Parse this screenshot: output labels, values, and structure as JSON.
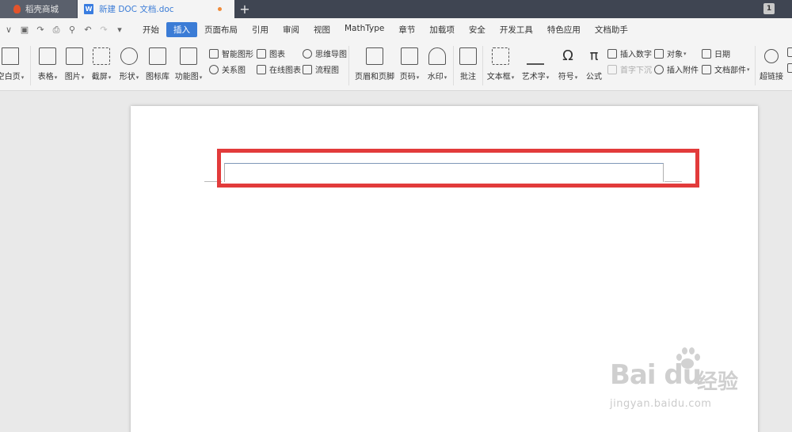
{
  "tabs": {
    "shop": "稻壳商城",
    "doc": "新建 DOC 文档.doc",
    "add": "+",
    "window_count": "1"
  },
  "menu": [
    "开始",
    "插入",
    "页面布局",
    "引用",
    "审阅",
    "视图",
    "MathType",
    "章节",
    "加载项",
    "安全",
    "开发工具",
    "特色应用",
    "文档助手"
  ],
  "active_menu": "插入",
  "ribbon": {
    "blank_page": "空白页",
    "table": "表格",
    "picture": "图片",
    "screenshot": "截屏",
    "shape": "形状",
    "icon_lib": "图标库",
    "func_chart": "功能图",
    "smart_shape": "智能图形",
    "chart": "图表",
    "mind_map": "思维导图",
    "relation": "关系图",
    "online_chart": "在线图表",
    "flowchart": "流程图",
    "header_footer": "页眉和页脚",
    "page_num": "页码",
    "watermark": "水印",
    "comment": "批注",
    "text_box": "文本框",
    "art_text": "艺术字",
    "symbol": "符号",
    "formula": "公式",
    "insert_number": "插入数字",
    "drop_cap": "首字下沉",
    "object": "对象",
    "attachment": "插入附件",
    "date": "日期",
    "doc_part": "文档部件",
    "hyperlink": "超链接"
  },
  "watermark": {
    "logo": "Bai du",
    "cn": "经验",
    "url": "jingyan.baidu.com"
  },
  "colors": {
    "accent": "#3b7cd6",
    "highlight": "#e23b3b",
    "tabbar": "#3f4552"
  }
}
